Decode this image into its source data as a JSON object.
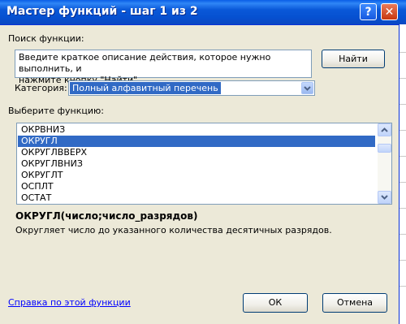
{
  "window": {
    "title": "Мастер функций - шаг 1 из 2",
    "help_glyph": "?",
    "close_glyph": "✕"
  },
  "search": {
    "label": "Поиск функции:",
    "text_line1": "Введите краткое описание действия, которое нужно выполнить, и",
    "text_line2": "нажмите кнопку \"Найти\"",
    "find_button": "Найти"
  },
  "category": {
    "label": "Категория:",
    "value": "Полный алфавитный перечень"
  },
  "functions": {
    "label": "Выберите функцию:",
    "items": [
      "ОКРВНИЗ",
      "ОКРУГЛ",
      "ОКРУГЛВВЕРХ",
      "ОКРУГЛВНИЗ",
      "ОКРУГЛТ",
      "ОСПЛТ",
      "ОСТАТ"
    ],
    "selected": "ОКРУГЛ"
  },
  "details": {
    "signature": "ОКРУГЛ(число;число_разрядов)",
    "description": "Округляет число до указанного количества десятичных разрядов."
  },
  "footer": {
    "help_link": "Справка по этой функции",
    "ok": "ОК",
    "cancel": "Отмена"
  },
  "colors": {
    "titlebar": "#0a58d8",
    "selection": "#316ac5",
    "dialog_bg": "#ece9d8",
    "link": "#0000ff"
  }
}
